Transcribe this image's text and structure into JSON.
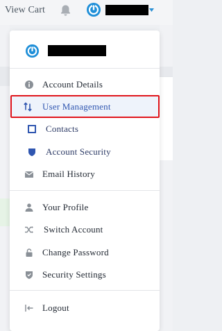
{
  "topbar": {
    "view_cart_label": "View Cart",
    "icons": [
      "bell-icon",
      "brand-logo-icon",
      "caret-down-icon"
    ],
    "accent_color": "#2a8fd4"
  },
  "dropdown": {
    "header_icon": "brand-logo-icon",
    "sections": [
      {
        "items": [
          {
            "label": "Account Details",
            "icon": "info-icon"
          },
          {
            "label": "User Management",
            "icon": "sort-arrows-icon",
            "active": true
          },
          {
            "label": "Contacts",
            "icon": "square-icon"
          },
          {
            "label": "Account Security",
            "icon": "shield-icon"
          },
          {
            "label": "Email History",
            "icon": "envelope-icon"
          }
        ]
      },
      {
        "items": [
          {
            "label": "Your Profile",
            "icon": "user-icon"
          },
          {
            "label": "Switch Account",
            "icon": "shuffle-icon"
          },
          {
            "label": "Change Password",
            "icon": "lock-icon"
          },
          {
            "label": "Security Settings",
            "icon": "shield-check-icon"
          }
        ]
      },
      {
        "items": [
          {
            "label": "Logout",
            "icon": "logout-icon"
          }
        ]
      }
    ],
    "highlight_color": "#e0141b",
    "active_color": "#2f56b0"
  }
}
